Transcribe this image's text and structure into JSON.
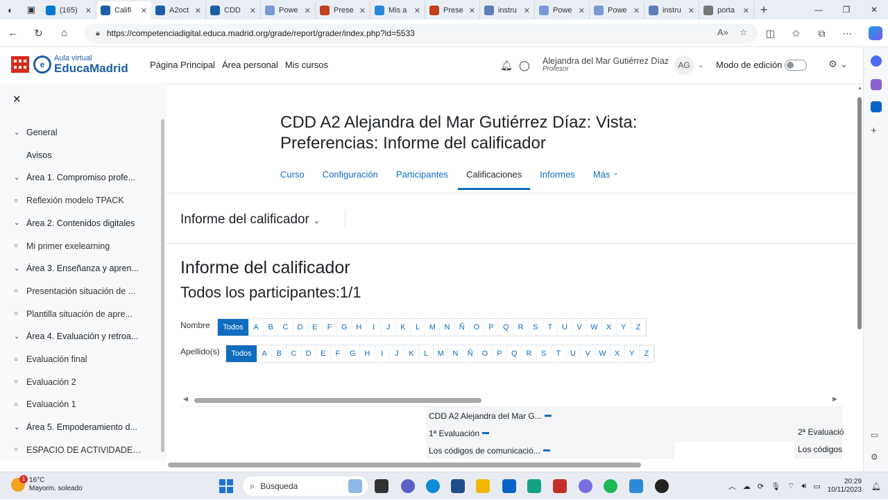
{
  "browser": {
    "tabs": [
      {
        "title": "(165)",
        "color": "#0078d4"
      },
      {
        "title": "Califi",
        "color": "#1d5fa5",
        "active": true
      },
      {
        "title": "A2oct",
        "color": "#1d5fa5"
      },
      {
        "title": "CDD",
        "color": "#1d5fa5"
      },
      {
        "title": "Powe",
        "color": "#7a9ad6"
      },
      {
        "title": "Prese",
        "color": "#c43e1c"
      },
      {
        "title": "Mis a",
        "color": "#2b88d8"
      },
      {
        "title": "Prese",
        "color": "#c43e1c"
      },
      {
        "title": "instru",
        "color": "#5c7fb8"
      },
      {
        "title": "Powe",
        "color": "#7a9ad6"
      },
      {
        "title": "Powe",
        "color": "#7a9ad6"
      },
      {
        "title": "instru",
        "color": "#5c7fb8"
      },
      {
        "title": "porta",
        "color": "#777777"
      }
    ],
    "url": "https://competenciadigital.educa.madrid.org/grade/report/grader/index.php?id=5533"
  },
  "header": {
    "logo_small": "Aula virtual",
    "logo_big": "EducaMadrid",
    "nav": [
      "Página Principal",
      "Área personal",
      "Mis cursos"
    ],
    "user_name": "Alejandra del Mar Gutiérrez Díaz",
    "user_role": "Profesor",
    "avatar_initials": "AG",
    "edit_mode_label": "Modo de edición",
    "edit_mode_on": false
  },
  "drawer": {
    "items": [
      {
        "type": "section",
        "label": "General"
      },
      {
        "type": "plain",
        "label": "Avisos"
      },
      {
        "type": "section",
        "label": "Área 1. Compromiso profe..."
      },
      {
        "type": "activity",
        "label": "Reflexión modelo TPACK"
      },
      {
        "type": "section",
        "label": "Área 2. Contenidos digitales"
      },
      {
        "type": "activity",
        "label": "Mi primer exelearning"
      },
      {
        "type": "section",
        "label": "Área 3. Enseñanza y apren..."
      },
      {
        "type": "activity",
        "label": "Presentación situación de ..."
      },
      {
        "type": "activity",
        "label": "Plantilla situación de apre..."
      },
      {
        "type": "section",
        "label": "Área 4. Evaluación y retroa..."
      },
      {
        "type": "activity",
        "label": "Evaluación final"
      },
      {
        "type": "activity",
        "label": "Evaluación 2"
      },
      {
        "type": "activity",
        "label": "Evaluación 1"
      },
      {
        "type": "section",
        "label": "Área 5. Empoderamiento d..."
      },
      {
        "type": "activity",
        "label": "ESPACIO DE ACTIVIDADES ..."
      }
    ]
  },
  "main": {
    "page_title": "CDD A2 Alejandra del Mar Gutiérrez Díaz: Vista: Preferencias: Informe del calificador",
    "tabs": [
      "Curso",
      "Configuración",
      "Participantes",
      "Calificaciones",
      "Informes",
      "Más"
    ],
    "active_tab": "Calificaciones",
    "report_selector": "Informe del calificador",
    "heading": "Informe del calificador",
    "subheading": "Todos los participantes:1/1",
    "first_name_label": "Nombre",
    "last_name_label": "Apellido(s)",
    "all_label": "Todos",
    "letters": [
      "A",
      "B",
      "C",
      "D",
      "E",
      "F",
      "G",
      "H",
      "I",
      "J",
      "K",
      "L",
      "M",
      "N",
      "Ñ",
      "O",
      "P",
      "Q",
      "R",
      "S",
      "T",
      "U",
      "V",
      "W",
      "X",
      "Y",
      "Z"
    ],
    "grader": {
      "row1": "CDD A2 Alejandra del Mar G...",
      "row2": "1ª Evaluación",
      "row2_right": "2ª Evaluació",
      "row3": "Los códigos de comunicació...",
      "row3_right": "Los códigos"
    }
  },
  "taskbar": {
    "weather_temp": "16°C",
    "weather_desc": "Mayorm. soleado",
    "weather_badge": "1",
    "search_placeholder": "Búsqueda",
    "time": "20:29",
    "date": "10/11/2023"
  }
}
